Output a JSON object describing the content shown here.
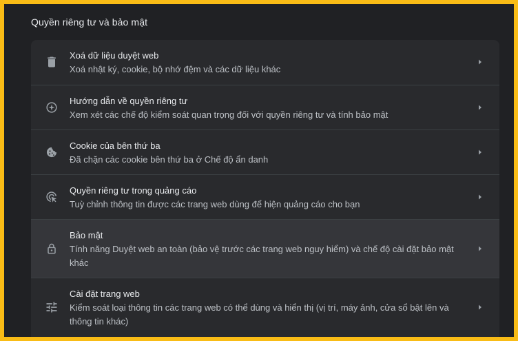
{
  "section": {
    "title": "Quyền riêng tư và bảo mật"
  },
  "items": [
    {
      "title": "Xoá dữ liệu duyệt web",
      "description": "Xoá nhật ký, cookie, bộ nhớ đệm và các dữ liệu khác",
      "icon": "trash-icon"
    },
    {
      "title": "Hướng dẫn về quyền riêng tư",
      "description": "Xem xét các chế độ kiểm soát quan trọng đối với quyền riêng tư và tính bảo mật",
      "icon": "privacy-guide-icon"
    },
    {
      "title": "Cookie của bên thứ ba",
      "description": "Đã chặn các cookie bên thứ ba ở Chế độ ẩn danh",
      "icon": "cookie-icon"
    },
    {
      "title": "Quyền riêng tư trong quảng cáo",
      "description": "Tuỳ chỉnh thông tin được các trang web dùng để hiện quảng cáo cho bạn",
      "icon": "ad-privacy-icon"
    },
    {
      "title": "Bảo mật",
      "description": "Tính năng Duyệt web an toàn (bảo vệ trước các trang web nguy hiểm) và chế độ cài đặt bảo mật khác",
      "icon": "lock-icon"
    },
    {
      "title": "Cài đặt trang web",
      "description": "Kiểm soát loại thông tin các trang web có thể dùng và hiển thị (vị trí, máy ảnh, cửa sổ bật lên và thông tin khác)",
      "icon": "tune-icon"
    }
  ],
  "colors": {
    "outer_frame": "#f9bc16",
    "page_bg": "#202124",
    "card_bg": "#292a2d",
    "hover_row_bg": "#35363a",
    "divider": "#3c4043",
    "text_primary": "#e8eaed",
    "text_secondary": "#bdc1c6",
    "icon": "#9aa0a6"
  }
}
